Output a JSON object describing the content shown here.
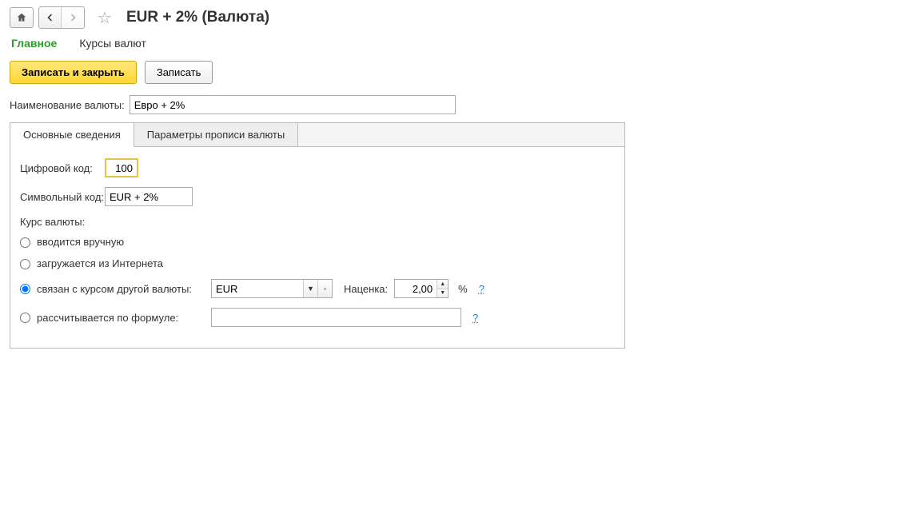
{
  "header": {
    "title": "EUR + 2% (Валюта)"
  },
  "nav": {
    "main": "Главное",
    "rates": "Курсы валют"
  },
  "buttons": {
    "save_close": "Записать и закрыть",
    "save": "Записать"
  },
  "fields": {
    "name_label": "Наименование валюты:",
    "name_value": "Евро + 2%"
  },
  "tabs": {
    "basic": "Основные сведения",
    "params": "Параметры прописи валюты"
  },
  "form": {
    "numeric_code_label": "Цифровой код:",
    "numeric_code_value": "100",
    "symbol_code_label": "Символьный код:",
    "symbol_code_value": "EUR + 2%",
    "rate_label": "Курс валюты:",
    "radio_manual": "вводится вручную",
    "radio_internet": "загружается из Интернета",
    "radio_related": "связан с курсом другой валюты:",
    "radio_formula": "рассчитывается по формуле:",
    "related_currency": "EUR",
    "markup_label": "Наценка:",
    "markup_value": "2,00",
    "percent": "%",
    "help": "?"
  }
}
